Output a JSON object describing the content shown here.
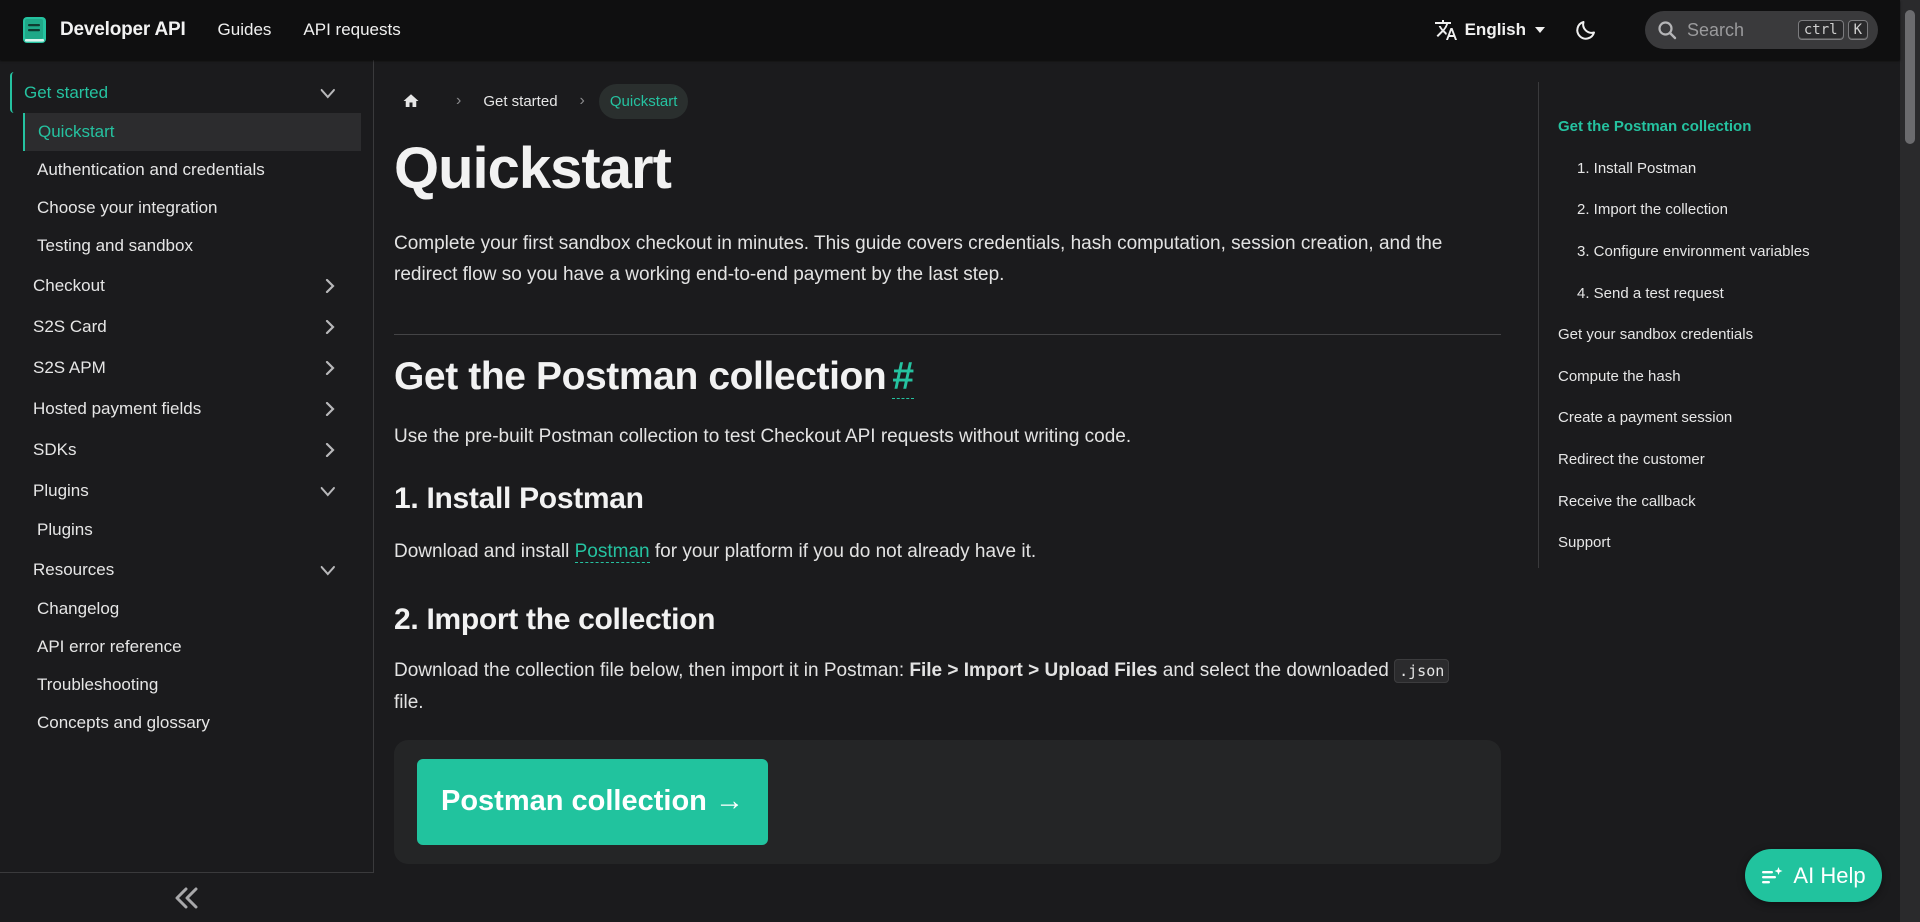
{
  "navbar": {
    "brand": "Developer API",
    "links": [
      "Guides",
      "API requests"
    ],
    "language": "English",
    "search_placeholder": "Search",
    "kbd_ctrl": "ctrl",
    "kbd_k": "K"
  },
  "sidebar": {
    "get_started": "Get started",
    "get_started_items": [
      "Quickstart",
      "Authentication and credentials",
      "Choose your integration",
      "Testing and sandbox"
    ],
    "checkout": "Checkout",
    "s2s_card": "S2S Card",
    "s2s_apm": "S2S APM",
    "hosted_fields": "Hosted payment fields",
    "sdks": "SDKs",
    "plugins": "Plugins",
    "plugins_items": [
      "Plugins"
    ],
    "resources": "Resources",
    "resources_items": [
      "Changelog",
      "API error reference",
      "Troubleshooting",
      "Concepts and glossary"
    ]
  },
  "breadcrumb": {
    "items": [
      "Get started",
      "Quickstart"
    ]
  },
  "main": {
    "title": "Quickstart",
    "lead": "Complete your first sandbox checkout in minutes. This guide covers credentials, hash computation, session creation, and the redirect flow so you have a working end-to-end payment by the last step.",
    "section_title": "Get the Postman collection",
    "section_anchor": "#",
    "section_desc": "Use the pre-built Postman collection to test Checkout API requests without writing code.",
    "step1_title": "1. Install Postman",
    "step1_pre": "Download and install ",
    "step1_link": "Postman",
    "step1_post": " for your platform if you do not already have it.",
    "step2_title": "2. Import the collection",
    "step2_pre": "Download the collection file below, then import it in Postman: ",
    "step2_bold": "File > Import > Upload Files",
    "step2_mid": " and select the downloaded ",
    "step2_code": ".json",
    "step2_post": "file.",
    "cta": "Postman collection →"
  },
  "toc": {
    "items": [
      "Get the Postman collection",
      "1. Install Postman",
      "2. Import the collection",
      "3. Configure environment variables",
      "4. Send a test request",
      "Get your sandbox credentials",
      "Compute the hash",
      "Create a payment session",
      "Redirect the customer",
      "Receive the callback",
      "Support"
    ]
  },
  "ai_help": "AI Help",
  "colors": {
    "accent": "#25c2a0",
    "background": "#1b1b1d",
    "navbar": "#0f0f10"
  }
}
